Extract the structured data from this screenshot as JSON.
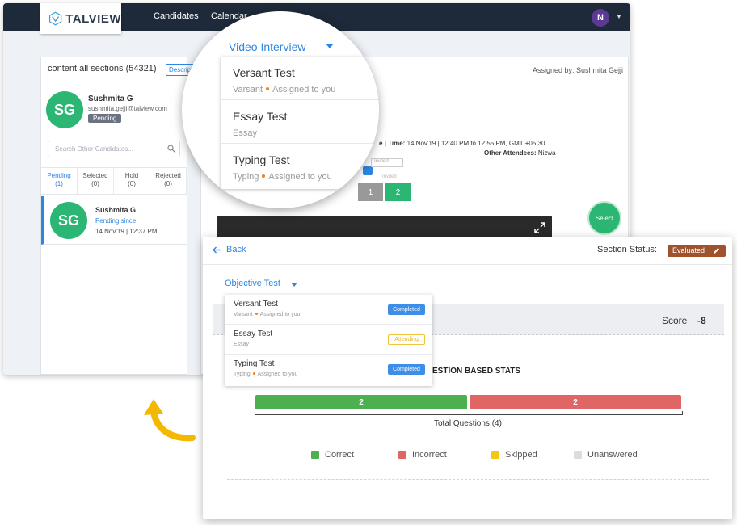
{
  "app": {
    "logo_text": "TALVIEW",
    "nav": [
      "Candidates",
      "Calendar"
    ],
    "user_initial": "N"
  },
  "left_panel": {
    "section_heading": "content all sections (54321)",
    "description_button": "Description",
    "candidate": {
      "initials": "SG",
      "name": "Sushmita G",
      "email": "sushmita.gejji@talview.com",
      "status": "Pending"
    },
    "search_placeholder": "Search Other Candidates...",
    "tabs": [
      {
        "label": "Pending",
        "count": "(1)"
      },
      {
        "label": "Selected",
        "count": "(0)"
      },
      {
        "label": "Hold",
        "count": "(0)"
      },
      {
        "label": "Rejected",
        "count": "(0)"
      }
    ],
    "card": {
      "initials": "SG",
      "name": "Sushmita G",
      "pending_label": "Pending since:",
      "date": "14 Nov'19 | 12:37 PM"
    }
  },
  "main_panel": {
    "assigned_by": "Assigned by: Sushmita Gejji",
    "time_prefix": "e | Time:",
    "time_value": "14 Nov'19 | 12:40 PM to 12:55 PM, GMT +05:30",
    "attendees_label": "Other Attendees:",
    "attendees_value": "Nizwa",
    "invited_label": "Invited",
    "pages": [
      "1",
      "2"
    ],
    "select_label": "Select"
  },
  "magnifier": {
    "title": "Video Interview",
    "items": [
      {
        "title": "Versant Test",
        "sub": "Varsant",
        "assigned": "Assigned to you"
      },
      {
        "title": "Essay Test",
        "sub": "Essay",
        "assigned": ""
      },
      {
        "title": "Typing Test",
        "sub": "Typing",
        "assigned": "Assigned to you"
      }
    ]
  },
  "evaluation": {
    "back_label": "Back",
    "section_status_label": "Section Status:",
    "section_status_value": "Evaluated",
    "test_selector": "Objective Test",
    "dropdown": [
      {
        "title": "Versant Test",
        "sub": "Varsant",
        "assigned": "Assigned to you",
        "badge": "Completed"
      },
      {
        "title": "Essay Test",
        "sub": "Essay",
        "assigned": "",
        "badge": "Attending"
      },
      {
        "title": "Typing Test",
        "sub": "Typing",
        "assigned": "Assigned to you",
        "badge": "Completed"
      }
    ],
    "score_label": "Score",
    "score_value": "-8",
    "stats_title": "ESTION BASED STATS",
    "correct_count": "2",
    "incorrect_count": "2",
    "total_questions": "Total Questions (4)",
    "legend": [
      {
        "label": "Correct",
        "color": "#4caf50"
      },
      {
        "label": "Incorrect",
        "color": "#e06666"
      },
      {
        "label": "Skipped",
        "color": "#f5c518"
      },
      {
        "label": "Unanswered",
        "color": "#dcdcdc"
      }
    ]
  },
  "colors": {
    "accent": "#2e86de",
    "topbar": "#1e2a3a",
    "green": "#2bb673",
    "evaluated": "#a0522d",
    "arrow": "#f5b800"
  }
}
